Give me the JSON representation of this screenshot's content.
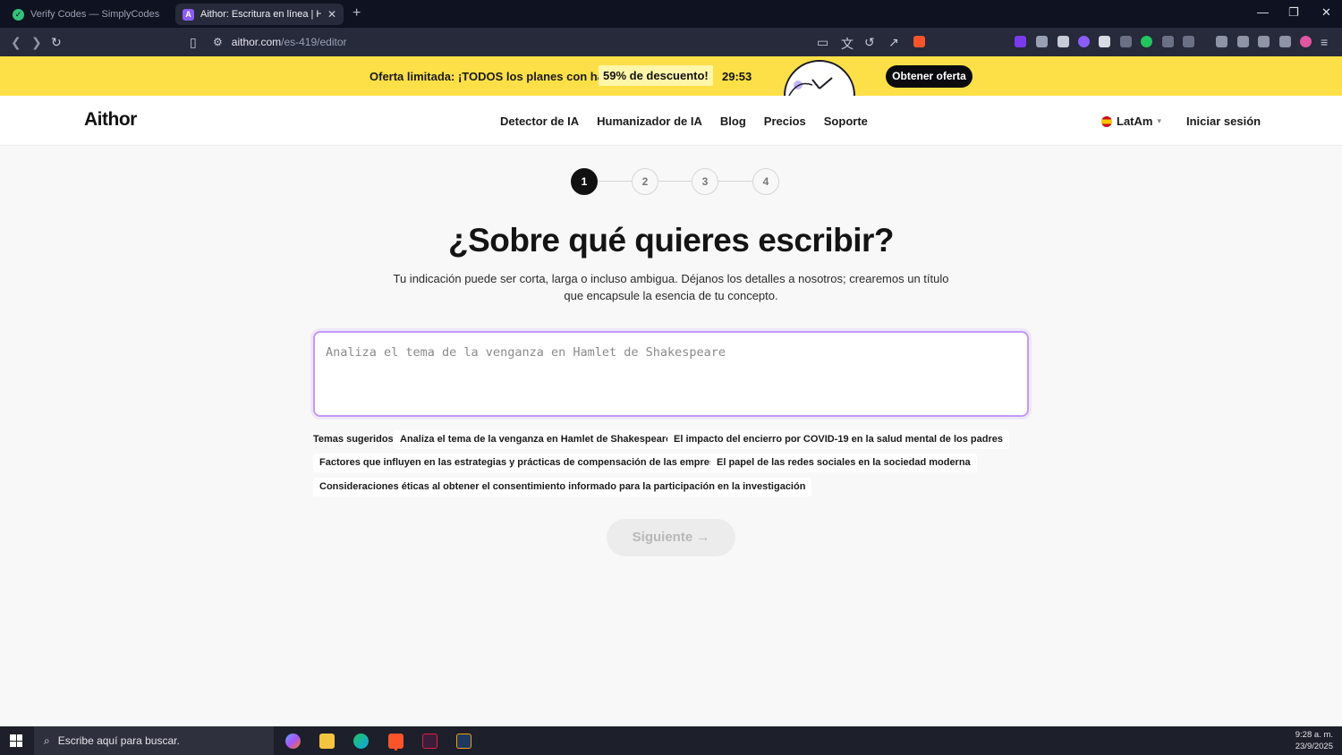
{
  "browser": {
    "tabs": [
      {
        "title": "Verify Codes — SimplyCodes",
        "active": false
      },
      {
        "title": "Aithor: Escritura en línea | Herran",
        "active": true
      }
    ],
    "url_host": "aithor.com",
    "url_path": "/es-419/editor"
  },
  "promo": {
    "text": "Oferta limitada: ¡TODOS los planes con hasta",
    "badge": "59% de descuento!",
    "timer": "29:53",
    "cta": "Obtener oferta"
  },
  "site": {
    "logo": "Aithor",
    "nav": [
      "Detector de IA",
      "Humanizador de IA",
      "Blog",
      "Precios",
      "Soporte"
    ],
    "language": "LatAm",
    "login": "Iniciar sesión"
  },
  "stepper": {
    "steps": [
      "1",
      "2",
      "3",
      "4"
    ],
    "current": 1
  },
  "main": {
    "heading": "¿Sobre qué quieres escribir?",
    "subtitle": "Tu indicación puede ser corta, larga o incluso ambigua. Déjanos los detalles a nosotros; crearemos un título que encapsule la esencia de tu concepto.",
    "prompt_placeholder": "Analiza el tema de la venganza en Hamlet de Shakespeare",
    "suggestions_label": "Temas sugeridos",
    "suggestions": [
      "Analiza el tema de la venganza en Hamlet de Shakespeare",
      "El impacto del encierro por COVID-19 en la salud mental de los padres",
      "Factores que influyen en las estrategias y prácticas de compensación de las empresas",
      "El papel de las redes sociales en la sociedad moderna",
      "Consideraciones éticas al obtener el consentimiento informado para la participación en la investigación"
    ],
    "next_label": "Siguiente",
    "next_arrow": "→"
  },
  "taskbar": {
    "search_placeholder": "Escribe aquí para buscar.",
    "time": "9:28 a. m.",
    "date": "23/9/2025"
  },
  "colors": {
    "promo_bg": "#fde047",
    "prompt_border": "#c499f7",
    "active_step": "#111111"
  }
}
